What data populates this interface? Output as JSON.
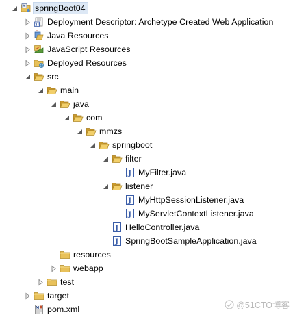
{
  "tree": [
    {
      "label": "springBoot04",
      "icon": "project-icon",
      "toggle": "expanded",
      "depth": 0,
      "selected": true
    },
    {
      "label": "Deployment Descriptor: Archetype Created Web Application",
      "icon": "deployment-descriptor-icon",
      "toggle": "collapsed",
      "depth": 1
    },
    {
      "label": "Java Resources",
      "icon": "java-resources-icon",
      "toggle": "collapsed",
      "depth": 1
    },
    {
      "label": "JavaScript Resources",
      "icon": "javascript-resources-icon",
      "toggle": "collapsed",
      "depth": 1
    },
    {
      "label": "Deployed Resources",
      "icon": "deployed-resources-icon",
      "toggle": "collapsed",
      "depth": 1
    },
    {
      "label": "src",
      "icon": "folder-open-icon",
      "toggle": "expanded",
      "depth": 1
    },
    {
      "label": "main",
      "icon": "folder-open-icon",
      "toggle": "expanded",
      "depth": 2
    },
    {
      "label": "java",
      "icon": "folder-open-icon",
      "toggle": "expanded",
      "depth": 3
    },
    {
      "label": "com",
      "icon": "folder-open-icon",
      "toggle": "expanded",
      "depth": 4
    },
    {
      "label": "mmzs",
      "icon": "folder-open-icon",
      "toggle": "expanded",
      "depth": 5
    },
    {
      "label": "springboot",
      "icon": "folder-open-icon",
      "toggle": "expanded",
      "depth": 6
    },
    {
      "label": "filter",
      "icon": "folder-open-icon",
      "toggle": "expanded",
      "depth": 7
    },
    {
      "label": "MyFilter.java",
      "icon": "java-file-icon",
      "toggle": "none",
      "depth": 8
    },
    {
      "label": "listener",
      "icon": "folder-open-icon",
      "toggle": "expanded",
      "depth": 7
    },
    {
      "label": "MyHttpSessionListener.java",
      "icon": "java-file-icon",
      "toggle": "none",
      "depth": 8
    },
    {
      "label": "MyServletContextListener.java",
      "icon": "java-file-icon",
      "toggle": "none",
      "depth": 8
    },
    {
      "label": "HelloController.java",
      "icon": "java-file-icon",
      "toggle": "none",
      "depth": 7
    },
    {
      "label": "SpringBootSampleApplication.java",
      "icon": "java-file-icon",
      "toggle": "none",
      "depth": 7
    },
    {
      "label": "resources",
      "icon": "folder-icon",
      "toggle": "none",
      "depth": 3
    },
    {
      "label": "webapp",
      "icon": "folder-icon",
      "toggle": "collapsed",
      "depth": 3
    },
    {
      "label": "test",
      "icon": "folder-icon",
      "toggle": "collapsed",
      "depth": 2
    },
    {
      "label": "target",
      "icon": "folder-icon",
      "toggle": "collapsed",
      "depth": 1
    },
    {
      "label": "pom.xml",
      "icon": "xml-file-icon",
      "toggle": "none",
      "depth": 1
    }
  ],
  "watermark": {
    "text": "@51CTO博客",
    "icon": "watermark-logo-icon"
  },
  "colors": {
    "folder": "#e8c15a",
    "folder_dark": "#c99a2e",
    "java_file_border": "#3a5da8",
    "selection": "#dde8f5"
  }
}
